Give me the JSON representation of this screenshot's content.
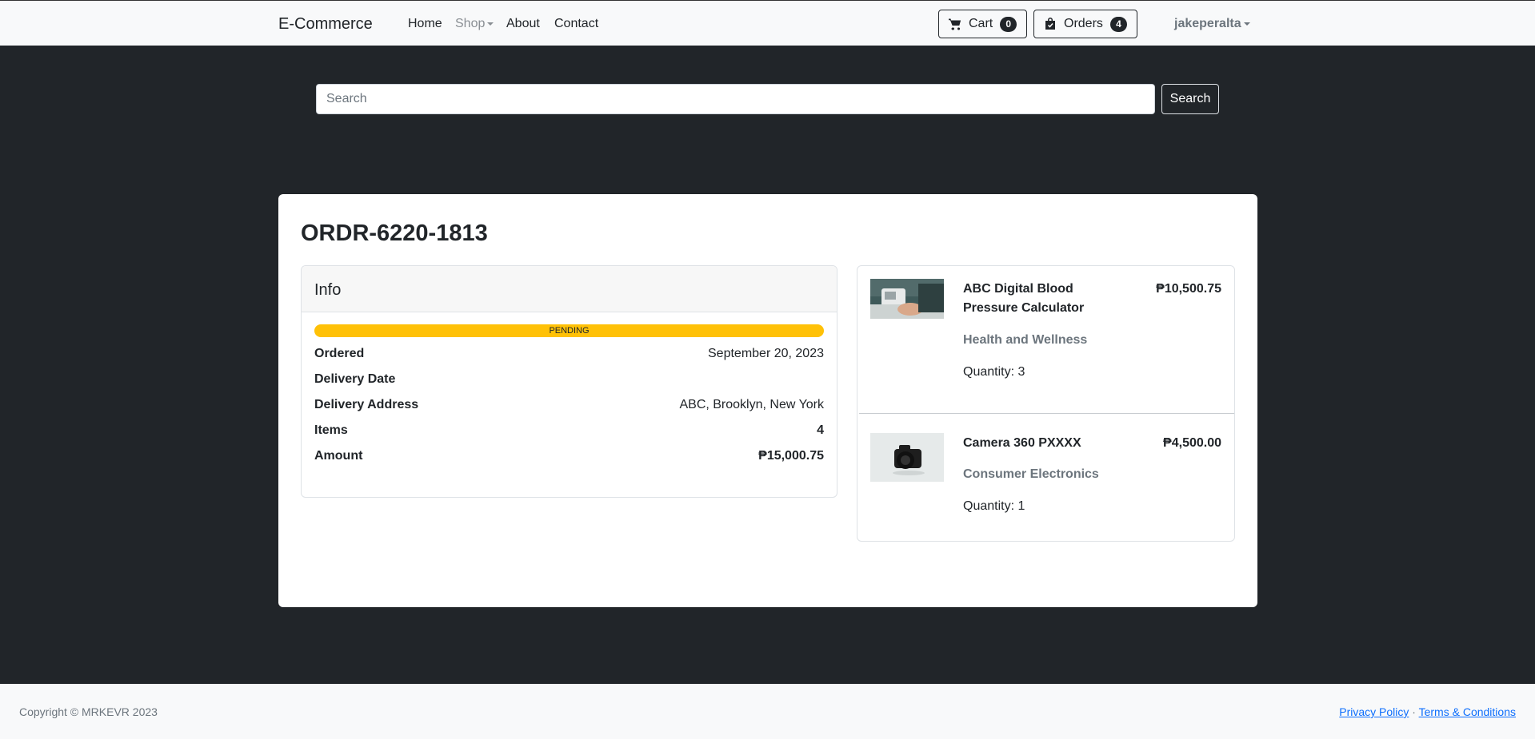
{
  "navbar": {
    "brand": "E-Commerce",
    "links": {
      "home": "Home",
      "shop": "Shop",
      "about": "About",
      "contact": "Contact"
    },
    "cart": {
      "label": "Cart",
      "count": "0"
    },
    "orders": {
      "label": "Orders",
      "count": "4"
    },
    "user": "jakeperalta"
  },
  "search": {
    "placeholder": "Search",
    "button": "Search"
  },
  "order": {
    "id": "ORDR-6220-1813",
    "info": {
      "title": "Info",
      "status": "PENDING",
      "status_color": "#ffc107",
      "ordered_label": "Ordered",
      "ordered_value": "September 20, 2023",
      "delivery_date_label": "Delivery Date",
      "delivery_date_value": "",
      "address_label": "Delivery Address",
      "address_value": "ABC, Brooklyn, New York",
      "items_label": "Items",
      "items_value": "4",
      "amount_label": "Amount",
      "amount_value": "₱15,000.75"
    },
    "items": [
      {
        "name": "ABC Digital Blood Pressure Calculator",
        "price": "₱10,500.75",
        "category": "Health and Wellness",
        "quantity": "Quantity: 3",
        "image_icon": "blood-pressure-monitor-image"
      },
      {
        "name": "Camera 360 PXXXX",
        "price": "₱4,500.00",
        "category": "Consumer Electronics",
        "quantity": "Quantity: 1",
        "image_icon": "camera-image"
      }
    ]
  },
  "footer": {
    "copyright": "Copyright © MRKEVR 2023",
    "privacy": "Privacy Policy",
    "separator": "·",
    "terms": "Terms & Conditions"
  }
}
